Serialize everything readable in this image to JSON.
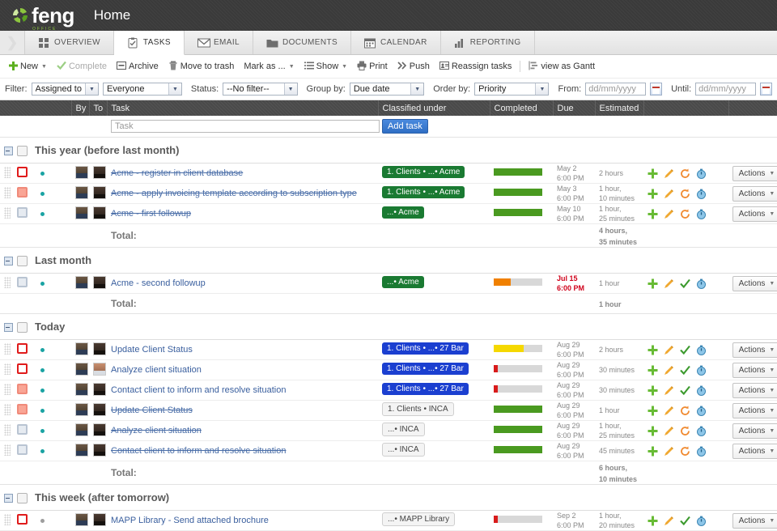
{
  "brand": {
    "name": "feng",
    "sub": "OFFICE",
    "page_title": "Home"
  },
  "tabs": [
    {
      "label": "OVERVIEW",
      "icon": "grid-icon",
      "active": false
    },
    {
      "label": "TASKS",
      "icon": "clipboard-icon",
      "active": true
    },
    {
      "label": "EMAIL",
      "icon": "envelope-icon",
      "active": false
    },
    {
      "label": "DOCUMENTS",
      "icon": "folder-icon",
      "active": false
    },
    {
      "label": "CALENDAR",
      "icon": "calendar-icon",
      "active": false
    },
    {
      "label": "REPORTING",
      "icon": "bar-chart-icon",
      "active": false
    }
  ],
  "toolbar": {
    "new": "New",
    "complete": "Complete",
    "archive": "Archive",
    "move_to_trash": "Move to trash",
    "mark_as": "Mark as ...",
    "show": "Show",
    "print": "Print",
    "push": "Push",
    "reassign": "Reassign tasks",
    "gantt": "view as Gantt"
  },
  "filters": {
    "filter_label": "Filter:",
    "filter_by": "Assigned to",
    "filter_value": "Everyone",
    "status_label": "Status:",
    "status_value": "--No filter--",
    "group_label": "Group by:",
    "group_value": "Due date",
    "order_label": "Order by:",
    "order_value": "Priority",
    "from_label": "From:",
    "from_placeholder": "dd/mm/yyyy",
    "until_label": "Until:",
    "until_placeholder": "dd/mm/yyyy"
  },
  "columns": {
    "by": "By",
    "to": "To",
    "task": "Task",
    "classified": "Classified under",
    "completed": "Completed",
    "due": "Due",
    "estimated": "Estimated"
  },
  "quickadd": {
    "placeholder": "Task",
    "button": "Add task"
  },
  "labels": {
    "total": "Total:",
    "actions": "Actions"
  },
  "colors": {
    "tag_green": "#1a7a32",
    "tag_blue": "#1b3fd0",
    "progress_green": "#4a9a20",
    "progress_yellow": "#f5d800",
    "progress_orange": "#f08000",
    "progress_red": "#d81b1b",
    "accent_blue": "#3a7bd0",
    "overdue_red": "#d0021b"
  },
  "groups": [
    {
      "title": "This year (before last month)",
      "total": "4 hours,\n35 minutes",
      "rows": [
        {
          "priority": "high",
          "dot": "teal",
          "by": "a1",
          "to": "a2",
          "task": "Acme - register in client database",
          "done": true,
          "tag": "1. Clients • ...• Acme",
          "tag_style": "green",
          "progress": 100,
          "progress_color": "#4a9a20",
          "due_date": "May 2",
          "due_time": "6:00 PM",
          "due_late": false,
          "estimated": "2 hours",
          "third_icon": "rotate-icon"
        },
        {
          "priority": "medium",
          "dot": "teal",
          "by": "a1",
          "to": "a2",
          "task": "Acme - apply invoicing template according to subscription type",
          "done": true,
          "tag": "1. Clients • ...• Acme",
          "tag_style": "green",
          "progress": 100,
          "progress_color": "#4a9a20",
          "due_date": "May 3",
          "due_time": "6:00 PM",
          "due_late": false,
          "estimated": "1 hour,\n10 minutes",
          "third_icon": "rotate-icon"
        },
        {
          "priority": "low",
          "dot": "teal",
          "by": "a1",
          "to": "a2",
          "task": "Acme - first followup",
          "done": true,
          "tag": "...• Acme",
          "tag_style": "green",
          "progress": 100,
          "progress_color": "#4a9a20",
          "due_date": "May 10",
          "due_time": "6:00 PM",
          "due_late": false,
          "estimated": "1 hour,\n25 minutes",
          "third_icon": "rotate-icon"
        }
      ]
    },
    {
      "title": "Last month",
      "total": "1 hour",
      "rows": [
        {
          "priority": "low",
          "dot": "teal",
          "by": "a1",
          "to": "a2",
          "task": "Acme - second followup",
          "done": false,
          "tag": "...• Acme",
          "tag_style": "green",
          "progress": 35,
          "progress_color": "#f08000",
          "due_date": "Jul 15",
          "due_time": "6:00 PM",
          "due_late": true,
          "estimated": "1 hour",
          "third_icon": "check-icon"
        }
      ]
    },
    {
      "title": "Today",
      "total": "6 hours,\n10 minutes",
      "rows": [
        {
          "priority": "high",
          "dot": "teal",
          "by": "a1",
          "to": "a2",
          "task": "Update Client Status",
          "done": false,
          "tag": "1. Clients • ...• 27 Bar",
          "tag_style": "blue",
          "progress": 62,
          "progress_color": "#f5d800",
          "due_date": "Aug 29",
          "due_time": "6:00 PM",
          "due_late": false,
          "estimated": "2 hours",
          "third_icon": "check-icon"
        },
        {
          "priority": "high",
          "dot": "teal",
          "by": "a1",
          "to": "a3",
          "task": "Analyze client situation",
          "done": false,
          "tag": "1. Clients • ...• 27 Bar",
          "tag_style": "blue",
          "progress": 8,
          "progress_color": "#d81b1b",
          "due_date": "Aug 29",
          "due_time": "6:00 PM",
          "due_late": false,
          "estimated": "30 minutes",
          "third_icon": "check-icon"
        },
        {
          "priority": "medium",
          "dot": "teal",
          "by": "a1",
          "to": "a2",
          "task": "Contact client to inform and resolve situation",
          "done": false,
          "tag": "1. Clients • ...• 27 Bar",
          "tag_style": "blue",
          "progress": 8,
          "progress_color": "#d81b1b",
          "due_date": "Aug 29",
          "due_time": "6:00 PM",
          "due_late": false,
          "estimated": "30 minutes",
          "third_icon": "check-icon"
        },
        {
          "priority": "medium",
          "dot": "teal",
          "by": "a1",
          "to": "a2",
          "task": "Update Client Status",
          "done": true,
          "tag": "1. Clients • INCA",
          "tag_style": "plain",
          "progress": 100,
          "progress_color": "#4a9a20",
          "due_date": "Aug 29",
          "due_time": "6:00 PM",
          "due_late": false,
          "estimated": "1 hour",
          "third_icon": "rotate-icon"
        },
        {
          "priority": "low",
          "dot": "teal",
          "by": "a1",
          "to": "a2",
          "task": "Analyze client situation",
          "done": true,
          "tag": "...• INCA",
          "tag_style": "plain",
          "progress": 100,
          "progress_color": "#4a9a20",
          "due_date": "Aug 29",
          "due_time": "6:00 PM",
          "due_late": false,
          "estimated": "1 hour,\n25 minutes",
          "third_icon": "rotate-icon"
        },
        {
          "priority": "low",
          "dot": "teal",
          "by": "a1",
          "to": "a2",
          "task": "Contact client to inform and resolve situation",
          "done": true,
          "tag": "...• INCA",
          "tag_style": "plain",
          "progress": 100,
          "progress_color": "#4a9a20",
          "due_date": "Aug 29",
          "due_time": "6:00 PM",
          "due_late": false,
          "estimated": "45 minutes",
          "third_icon": "rotate-icon"
        }
      ]
    },
    {
      "title": "This week (after tomorrow)",
      "total": null,
      "rows": [
        {
          "priority": "high",
          "dot": "gray",
          "by": "a1",
          "to": "a2",
          "task": "MAPP Library - Send attached brochure",
          "done": false,
          "tag": "...• MAPP Library",
          "tag_style": "plain",
          "progress": 8,
          "progress_color": "#d81b1b",
          "due_date": "Sep 2",
          "due_time": "6:00 PM",
          "due_late": false,
          "estimated": "1 hour,\n20 minutes",
          "third_icon": "check-icon"
        }
      ]
    }
  ]
}
